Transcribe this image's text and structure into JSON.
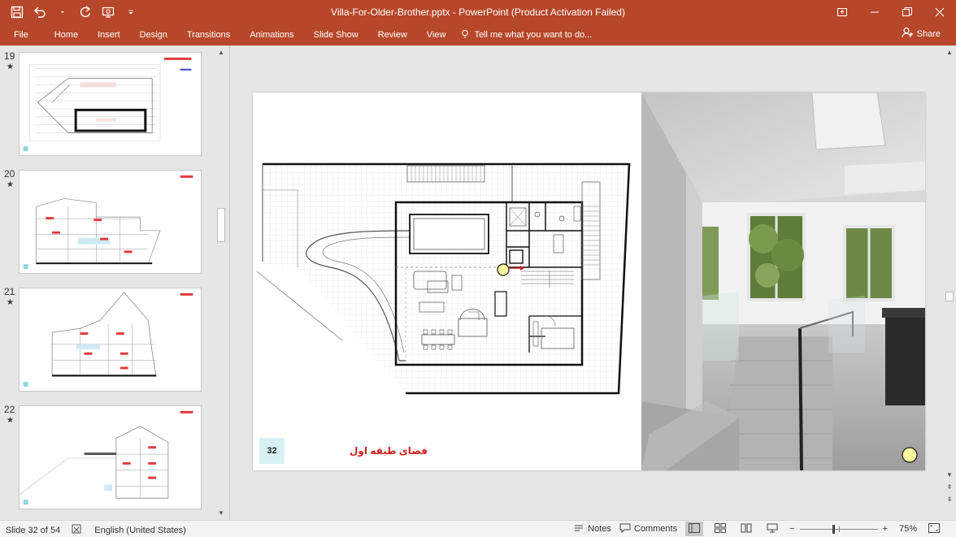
{
  "window": {
    "title": "Villa-For-Older-Brother.pptx - PowerPoint (Product Activation Failed)",
    "qat_icons": [
      "save-icon",
      "undo-icon",
      "redo-icon",
      "slideshow-icon",
      "customize-icon"
    ]
  },
  "ribbon": {
    "tabs": [
      "File",
      "Home",
      "Insert",
      "Design",
      "Transitions",
      "Animations",
      "Slide Show",
      "Review",
      "View"
    ],
    "tell_me": "Tell me what you want to do...",
    "share": "Share"
  },
  "thumbnails": [
    {
      "number": "19",
      "star": "★"
    },
    {
      "number": "20",
      "star": "★"
    },
    {
      "number": "21",
      "star": "★"
    },
    {
      "number": "22",
      "star": "★"
    }
  ],
  "slide": {
    "number_badge": "32",
    "caption": "فضای طبقه اول"
  },
  "status": {
    "slide_info": "Slide 32 of 54",
    "language": "English (United States)",
    "notes": "Notes",
    "comments": "Comments",
    "zoom_percent": "75%",
    "zoom_minus": "−",
    "zoom_plus": "+"
  },
  "colors": {
    "accent": "#b7472a",
    "caption": "#d21f1f",
    "badge": "#d8f2f4",
    "marker": "#fff9a0"
  }
}
